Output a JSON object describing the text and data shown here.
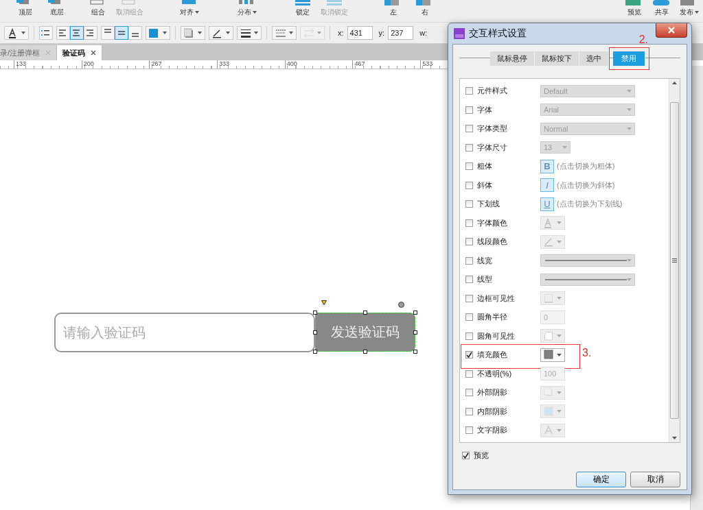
{
  "main_toolbar": {
    "items": [
      {
        "label": "顶层",
        "kind": "stack",
        "disabled": false,
        "caret": false
      },
      {
        "label": "底层",
        "kind": "stack",
        "disabled": false,
        "caret": false
      },
      {
        "label": "组合",
        "kind": "frame",
        "disabled": false,
        "caret": false
      },
      {
        "label": "取消组合",
        "kind": "frame",
        "disabled": true,
        "caret": false
      },
      {
        "label": "对齐",
        "kind": "bar",
        "disabled": false,
        "caret": true
      },
      {
        "label": "分布",
        "kind": "bars",
        "disabled": false,
        "caret": true
      },
      {
        "label": "锁定",
        "kind": "lock",
        "disabled": false,
        "caret": false
      },
      {
        "label": "取消锁定",
        "kind": "lock",
        "disabled": true,
        "caret": false
      },
      {
        "label": "左",
        "kind": "half",
        "disabled": false,
        "caret": false
      },
      {
        "label": "右",
        "kind": "half",
        "disabled": false,
        "caret": false
      }
    ],
    "right_items": [
      {
        "label": "预览",
        "kind": "play",
        "caret": false
      },
      {
        "label": "共享",
        "kind": "share",
        "caret": false
      },
      {
        "label": "发布",
        "kind": "publish",
        "caret": true
      }
    ]
  },
  "format_toolbar": {
    "tools": [
      {
        "kind": "font-color",
        "selected": false,
        "disabled": false
      },
      {
        "kind": "bullets",
        "selected": false,
        "disabled": false
      },
      {
        "kind": "align-left",
        "selected": false,
        "disabled": false
      },
      {
        "kind": "align-center",
        "selected": true,
        "disabled": false
      },
      {
        "kind": "align-right",
        "selected": false,
        "disabled": false
      },
      {
        "kind": "valign-top",
        "selected": false,
        "disabled": false
      },
      {
        "kind": "valign-middle",
        "selected": true,
        "disabled": false
      },
      {
        "kind": "valign-bottom",
        "selected": false,
        "disabled": false
      },
      {
        "kind": "fill",
        "selected": false,
        "disabled": false
      },
      {
        "kind": "shadow",
        "selected": false,
        "disabled": false
      },
      {
        "kind": "line-color",
        "selected": false,
        "disabled": false
      },
      {
        "kind": "line-width",
        "selected": false,
        "disabled": false
      },
      {
        "kind": "line-style",
        "selected": false,
        "disabled": false
      },
      {
        "kind": "arrow-style",
        "selected": false,
        "disabled": true
      }
    ],
    "fields": [
      {
        "label": "x:",
        "value": "431"
      },
      {
        "label": "y:",
        "value": "237"
      },
      {
        "label": "w:"
      }
    ]
  },
  "page_tabs": [
    {
      "label": "录/注册弹框",
      "selected": false
    },
    {
      "label": "验证码",
      "selected": true
    }
  ],
  "ruler": [
    "133",
    "200",
    "267",
    "333",
    "400",
    "467",
    "533"
  ],
  "canvas": {
    "input": {
      "placeholder": "请输入验证码"
    },
    "button": {
      "label": "发送验证码"
    }
  },
  "dialog": {
    "title": "交互样式设置",
    "tabs": [
      {
        "label": "鼠标悬停",
        "selected": false
      },
      {
        "label": "鼠标按下",
        "selected": false
      },
      {
        "label": "选中",
        "selected": false
      },
      {
        "label": "禁用",
        "selected": true,
        "note": "2."
      }
    ],
    "properties": [
      {
        "label": "元件样式",
        "checked": false,
        "kind": "select",
        "value": "Default"
      },
      {
        "label": "字体",
        "checked": false,
        "kind": "select",
        "value": "Arial"
      },
      {
        "label": "字体类型",
        "checked": false,
        "kind": "select",
        "value": "Normal"
      },
      {
        "label": "字体尺寸",
        "checked": false,
        "kind": "short-select",
        "value": "13"
      },
      {
        "label": "粗体",
        "checked": false,
        "kind": "toggle",
        "glyph": "B",
        "hint": "(点击切换为粗体)"
      },
      {
        "label": "斜体",
        "checked": false,
        "kind": "toggle",
        "glyph": "I",
        "hint": "(点击切换为斜体)"
      },
      {
        "label": "下划线",
        "checked": false,
        "kind": "toggle",
        "glyph": "U",
        "hint": "(点击切换为下划线)"
      },
      {
        "label": "字体颜色",
        "checked": false,
        "kind": "font-color"
      },
      {
        "label": "线段颜色",
        "checked": false,
        "kind": "line-color"
      },
      {
        "label": "线宽",
        "checked": false,
        "kind": "line"
      },
      {
        "label": "线型",
        "checked": false,
        "kind": "line"
      },
      {
        "label": "边框可见性",
        "checked": false,
        "kind": "border"
      },
      {
        "label": "圆角半径",
        "checked": false,
        "kind": "number",
        "value": "0"
      },
      {
        "label": "圆角可见性",
        "checked": false,
        "kind": "corner"
      },
      {
        "label": "填充颜色",
        "checked": true,
        "kind": "fill",
        "note": "3."
      },
      {
        "label": "不透明(%)",
        "checked": false,
        "kind": "number",
        "value": "100"
      },
      {
        "label": "外部阴影",
        "checked": false,
        "kind": "outer-shadow"
      },
      {
        "label": "内部阴影",
        "checked": false,
        "kind": "inner-shadow"
      },
      {
        "label": "文字阴影",
        "checked": false,
        "kind": "text-shadow"
      }
    ],
    "preview": {
      "label": "预览",
      "checked": true
    },
    "buttons": [
      {
        "label": "确定",
        "kind": "primary"
      },
      {
        "label": "取消",
        "kind": "secondary"
      }
    ]
  }
}
